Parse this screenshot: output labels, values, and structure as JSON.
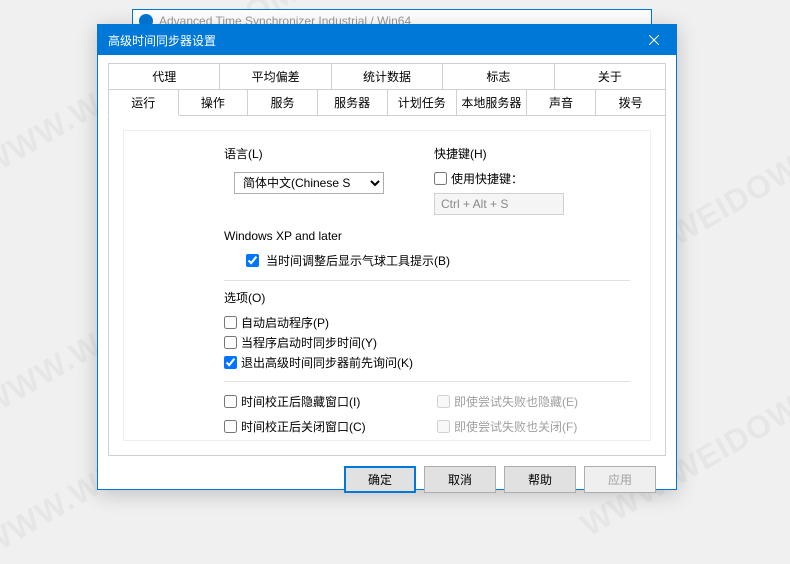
{
  "bg_window": {
    "title": "Advanced Time Synchronizer Industrial / Win64"
  },
  "dialog": {
    "title": "高级时间同步器设置",
    "tabs_row1": [
      "代理",
      "平均偏差",
      "统计数据",
      "标志",
      "关于"
    ],
    "tabs_row2": [
      "运行",
      "操作",
      "服务",
      "服务器",
      "计划任务",
      "本地服务器",
      "声音",
      "拨号"
    ],
    "active_tab": "运行"
  },
  "language": {
    "label": "语言(L)",
    "selected": "简体中文(Chinese S"
  },
  "shortcut": {
    "label": "快捷键(H)",
    "use_label": "使用快捷键：",
    "use_checked": false,
    "value": "Ctrl + Alt + S"
  },
  "winxp": {
    "label": "Windows XP and later",
    "balloon_label": "当时间调整后显示气球工具提示(B)",
    "balloon_checked": true
  },
  "options": {
    "label": "选项(O)",
    "autostart_label": "自动启动程序(P)",
    "autostart_checked": false,
    "sync_on_start_label": "当程序启动时同步时间(Y)",
    "sync_on_start_checked": false,
    "confirm_exit_label": "退出高级时间同步器前先询问(K)",
    "confirm_exit_checked": true
  },
  "window_opts": {
    "hide_after_correct_label": "时间校正后隐藏窗口(I)",
    "hide_after_correct_checked": false,
    "hide_on_fail_label": "即使尝试失败也隐藏(E)",
    "hide_on_fail_checked": false,
    "close_after_correct_label": "时间校正后关闭窗口(C)",
    "close_after_correct_checked": false,
    "close_on_fail_label": "即使尝试失败也关闭(F)",
    "close_on_fail_checked": false
  },
  "buttons": {
    "ok": "确定",
    "cancel": "取消",
    "help": "帮助",
    "apply": "应用"
  },
  "watermark": "WWW.WEIDOWN.COM"
}
